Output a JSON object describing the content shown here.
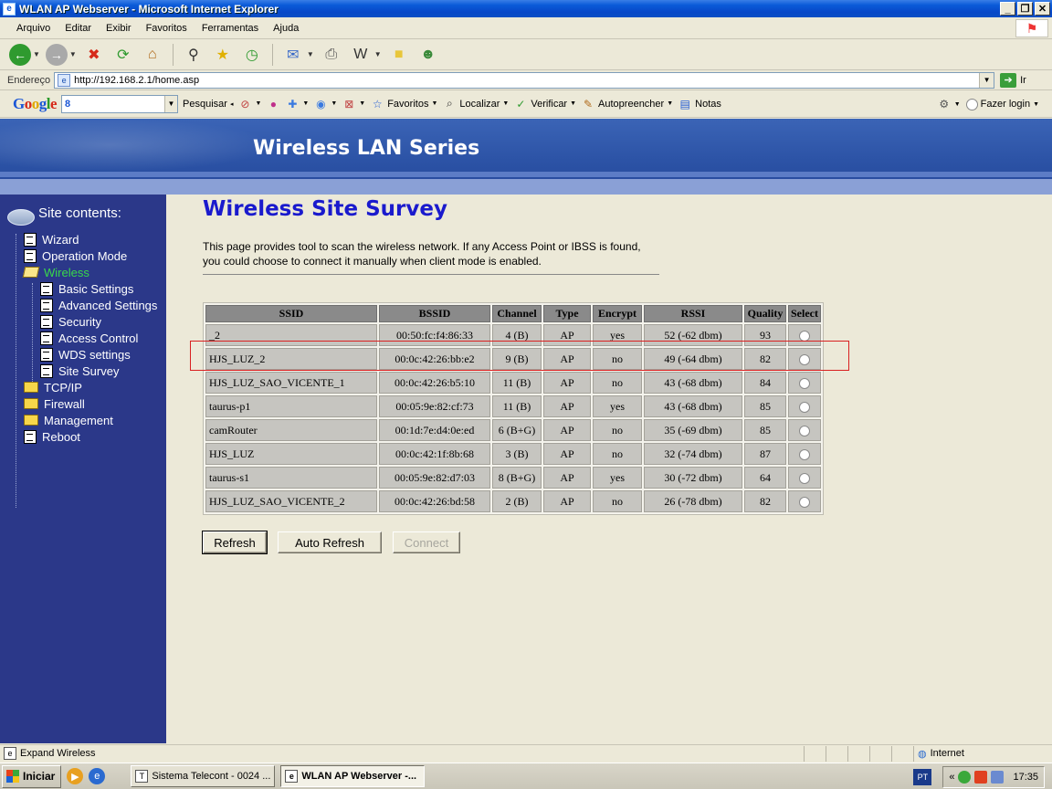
{
  "window": {
    "title": "WLAN AP Webserver - Microsoft Internet Explorer"
  },
  "menu": [
    "Arquivo",
    "Editar",
    "Exibir",
    "Favoritos",
    "Ferramentas",
    "Ajuda"
  ],
  "address": {
    "label": "Endereço",
    "url": "http://192.168.2.1/home.asp",
    "go_label": "Ir"
  },
  "google_toolbar": {
    "search_value": "8",
    "search_label": "Pesquisar",
    "favorites_label": "Favoritos",
    "locate_label": "Localizar",
    "verify_label": "Verificar",
    "autofill_label": "Autopreencher",
    "notes_label": "Notas",
    "login_label": "Fazer login"
  },
  "banner": {
    "title": "Wireless LAN Series"
  },
  "sidebar": {
    "heading": "Site contents:",
    "items": [
      {
        "label": "Wizard",
        "icon": "page-icon",
        "level": 1
      },
      {
        "label": "Operation Mode",
        "icon": "page-icon",
        "level": 1
      },
      {
        "label": "Wireless",
        "icon": "folder-open-icon",
        "level": 1,
        "active": true
      },
      {
        "label": "Basic Settings",
        "icon": "page-icon",
        "level": 2
      },
      {
        "label": "Advanced Settings",
        "icon": "page-icon",
        "level": 2
      },
      {
        "label": "Security",
        "icon": "page-icon",
        "level": 2
      },
      {
        "label": "Access Control",
        "icon": "page-icon",
        "level": 2
      },
      {
        "label": "WDS settings",
        "icon": "page-icon",
        "level": 2
      },
      {
        "label": "Site Survey",
        "icon": "page-icon",
        "level": 2
      },
      {
        "label": "TCP/IP",
        "icon": "folder-icon",
        "level": 1
      },
      {
        "label": "Firewall",
        "icon": "folder-icon",
        "level": 1
      },
      {
        "label": "Management",
        "icon": "folder-icon",
        "level": 1
      },
      {
        "label": "Reboot",
        "icon": "page-icon",
        "level": 1
      }
    ]
  },
  "content": {
    "title": "Wireless Site Survey",
    "description": "This page provides tool to scan the wireless network. If any Access Point or IBSS is found, you could choose to connect it manually when client mode is enabled."
  },
  "survey_table": {
    "headers": [
      "SSID",
      "BSSID",
      "Channel",
      "Type",
      "Encrypt",
      "RSSI",
      "Quality",
      "Select"
    ],
    "rows": [
      [
        "_2",
        "00:50:fc:f4:86:33",
        "4 (B)",
        "AP",
        "yes",
        "52 (-62 dbm)",
        "93"
      ],
      [
        "HJS_LUZ_2",
        "00:0c:42:26:bb:e2",
        "9 (B)",
        "AP",
        "no",
        "49 (-64 dbm)",
        "82"
      ],
      [
        "HJS_LUZ_SAO_VICENTE_1",
        "00:0c:42:26:b5:10",
        "11 (B)",
        "AP",
        "no",
        "43 (-68 dbm)",
        "84"
      ],
      [
        "taurus-p1",
        "00:05:9e:82:cf:73",
        "11 (B)",
        "AP",
        "yes",
        "43 (-68 dbm)",
        "85"
      ],
      [
        "camRouter",
        "00:1d:7e:d4:0e:ed",
        "6 (B+G)",
        "AP",
        "no",
        "35 (-69 dbm)",
        "85"
      ],
      [
        "HJS_LUZ",
        "00:0c:42:1f:8b:68",
        "3 (B)",
        "AP",
        "no",
        "32 (-74 dbm)",
        "87"
      ],
      [
        "taurus-s1",
        "00:05:9e:82:d7:03",
        "8 (B+G)",
        "AP",
        "yes",
        "30 (-72 dbm)",
        "64"
      ],
      [
        "HJS_LUZ_SAO_VICENTE_2",
        "00:0c:42:26:bd:58",
        "2 (B)",
        "AP",
        "no",
        "26 (-78 dbm)",
        "82"
      ]
    ]
  },
  "buttons": {
    "refresh": "Refresh",
    "auto_refresh": "Auto Refresh",
    "connect": "Connect"
  },
  "status": {
    "text": "Expand Wireless",
    "zone": "Internet"
  },
  "taskbar": {
    "start": "Iniciar",
    "tasks": [
      "Sistema Telecont - 0024 ...",
      "WLAN AP Webserver -..."
    ],
    "lang": "PT",
    "clock": "17:35"
  },
  "colors": {
    "banner": "#2c53a6",
    "sidebar": "#2b3889",
    "title_blue": "#1a1acd",
    "active_item": "#39d84a",
    "highlight": "#d92020"
  }
}
